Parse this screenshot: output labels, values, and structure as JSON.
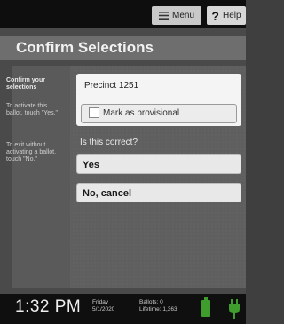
{
  "header": {
    "menu_label": "Menu",
    "help_label": "Help"
  },
  "title": "Confirm Selections",
  "sidebar": {
    "heading": "Confirm your selections",
    "instruction_activate": "To activate this ballot, touch \"Yes.\"",
    "instruction_exit": "To exit without activating a ballot, touch \"No.\""
  },
  "card": {
    "precinct": "Precinct 1251",
    "provisional_label": "Mark as provisional",
    "provisional_checked": false
  },
  "question": "Is this correct?",
  "answers": {
    "yes": "Yes",
    "no": "No, cancel"
  },
  "status": {
    "time": "1:32 PM",
    "day": "Friday",
    "date": "5/1/2020",
    "ballots_line": "Ballots: 0",
    "lifetime_line": "Lifetime: 1,363",
    "battery_color": "#3f9d2e",
    "plug_color": "#3f9d2e"
  }
}
